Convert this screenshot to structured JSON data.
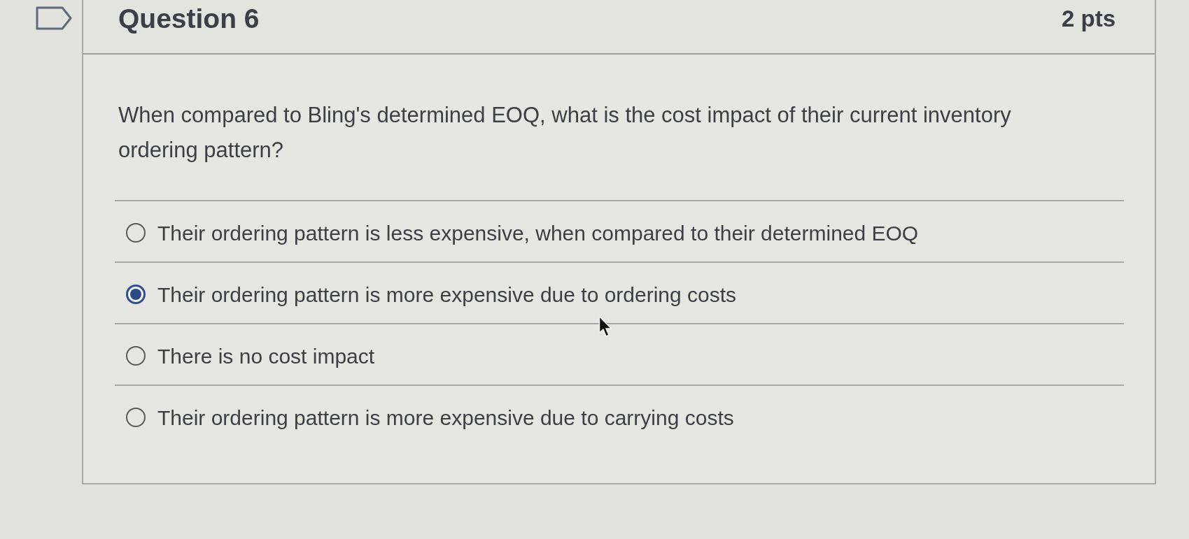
{
  "question": {
    "title": "Question 6",
    "points": "2 pts",
    "text": "When compared to Bling's determined EOQ, what is the cost impact of their current inventory ordering pattern?",
    "answers": [
      {
        "label": "Their ordering pattern is less expensive, when compared to their determined EOQ",
        "selected": false
      },
      {
        "label": "Their ordering pattern is more expensive due to ordering costs",
        "selected": true
      },
      {
        "label": "There is no cost impact",
        "selected": false
      },
      {
        "label": "Their ordering pattern is more expensive due to carrying costs",
        "selected": false
      }
    ]
  }
}
